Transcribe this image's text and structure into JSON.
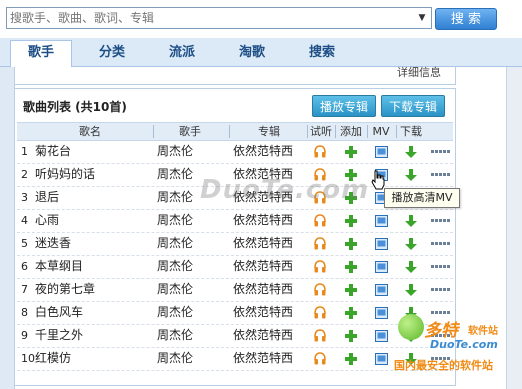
{
  "search": {
    "placeholder": "搜歌手、歌曲、歌词、专辑",
    "dropdown_glyph": "▼",
    "button": "搜 索"
  },
  "tabs": [
    {
      "label": "歌手",
      "active": true
    },
    {
      "label": "分类",
      "active": false
    },
    {
      "label": "流派",
      "active": false
    },
    {
      "label": "淘歌",
      "active": false
    },
    {
      "label": "搜索",
      "active": false
    }
  ],
  "upper_panel_text": "详细信息",
  "panel": {
    "title": "歌曲列表 (共10首)",
    "play_album": "播放专辑",
    "download_album": "下载专辑"
  },
  "columns": {
    "name": "歌名",
    "singer": "歌手",
    "album": "专辑",
    "listen": "试听",
    "add": "添加",
    "mv": "MV",
    "download": "下载"
  },
  "songs": [
    {
      "num": "1",
      "name": "菊花台",
      "singer": "周杰伦",
      "album": "依然范特西"
    },
    {
      "num": "2",
      "name": "听妈妈的话",
      "singer": "周杰伦",
      "album": "依然范特西"
    },
    {
      "num": "3",
      "name": "退后",
      "singer": "周杰伦",
      "album": "依然范特西"
    },
    {
      "num": "4",
      "name": "心雨",
      "singer": "周杰伦",
      "album": "依然范特西"
    },
    {
      "num": "5",
      "name": "迷迭香",
      "singer": "周杰伦",
      "album": "依然范特西"
    },
    {
      "num": "6",
      "name": "本草纲目",
      "singer": "周杰伦",
      "album": "依然范特西"
    },
    {
      "num": "7",
      "name": "夜的第七章",
      "singer": "周杰伦",
      "album": "依然范特西"
    },
    {
      "num": "8",
      "name": "白色风车",
      "singer": "周杰伦",
      "album": "依然范特西"
    },
    {
      "num": "9",
      "name": "千里之外",
      "singer": "周杰伦",
      "album": "依然范特西"
    },
    {
      "num": "10",
      "name": "红模仿",
      "singer": "周杰伦",
      "album": "依然范特西"
    }
  ],
  "tooltip": "播放高清MV",
  "watermarks": {
    "center": "DuoTe.com",
    "logo_title": "多特",
    "logo_site": "软件站",
    "logo_url": "DuoTe.com",
    "logo_slogan": "国内最安全的软件站"
  },
  "colors": {
    "accent_blue": "#2f7fd3",
    "tab_bg": "#dce9f6",
    "add_green": "#3aa52a",
    "listen_orange": "#e8891e"
  }
}
